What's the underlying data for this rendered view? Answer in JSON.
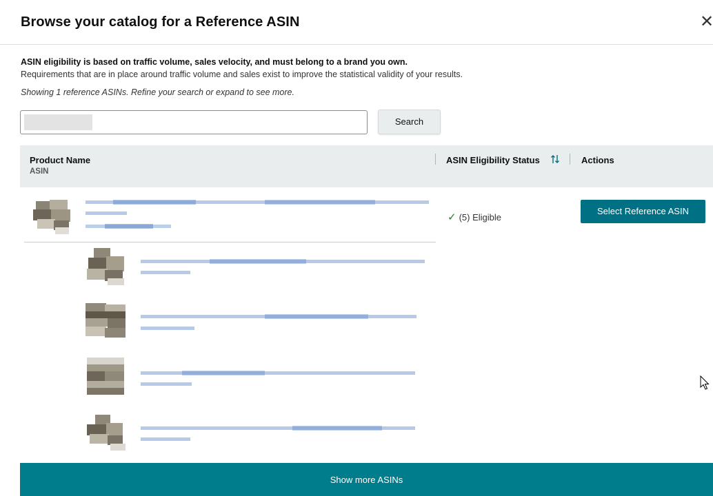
{
  "modal": {
    "title": "Browse your catalog for a Reference ASIN",
    "close_symbol": "✕"
  },
  "info": {
    "bold": "ASIN eligibility is based on traffic volume, sales velocity, and must belong to a brand you own.",
    "text": "Requirements that are in place around traffic volume and sales exist to improve the statistical validity of your results.",
    "showing": "Showing 1 reference ASINs. Refine your search or expand to see more."
  },
  "search": {
    "value": "",
    "button_label": "Search"
  },
  "table": {
    "col_product": "Product Name",
    "col_asin": "ASIN",
    "col_status": "ASIN Eligibility Status",
    "col_actions": "Actions",
    "sort_icon": "sort-arrows-icon"
  },
  "row": {
    "status_text": "(5) Eligible",
    "status_icon": "check-icon",
    "action_label": "Select Reference ASIN"
  },
  "footer": {
    "show_more_label": "Show more ASINs"
  },
  "colors": {
    "primary_teal": "#007185",
    "footer_teal": "#007d8c",
    "header_bg": "#e9eded",
    "check_green": "#2d7a2d"
  }
}
